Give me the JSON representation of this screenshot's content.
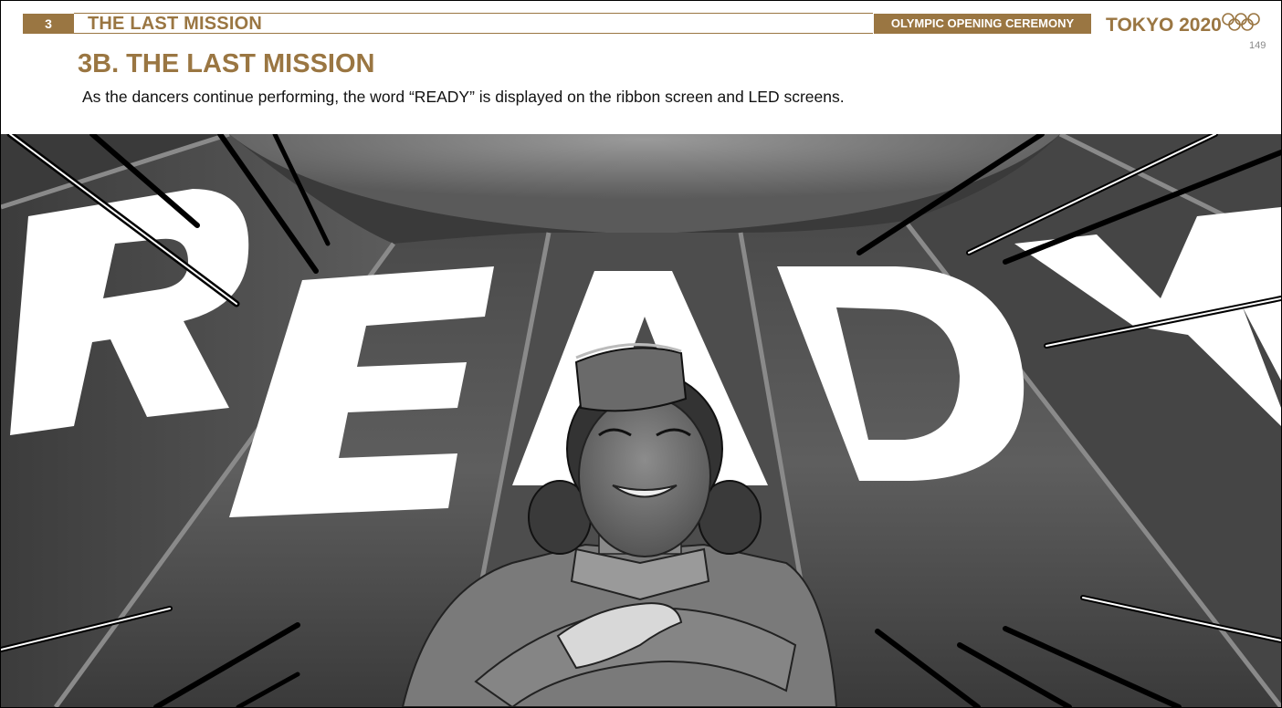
{
  "header": {
    "section_number": "3",
    "section_title": "THE LAST MISSION",
    "ceremony_label": "OLYMPIC OPENING CEREMONY",
    "event_name": "TOKYO 2020",
    "rings_icon": "olympic-rings-icon",
    "page_number": "149"
  },
  "scene": {
    "heading": "3B. THE LAST MISSION",
    "caption": "As the dancers continue performing, the word “READY” is displayed on the ribbon screen and LED screens."
  },
  "illustration": {
    "screen_word": "READY",
    "icon": "storyboard-illustration"
  },
  "colors": {
    "brand_gold": "#9a7642",
    "text": "#111111"
  }
}
